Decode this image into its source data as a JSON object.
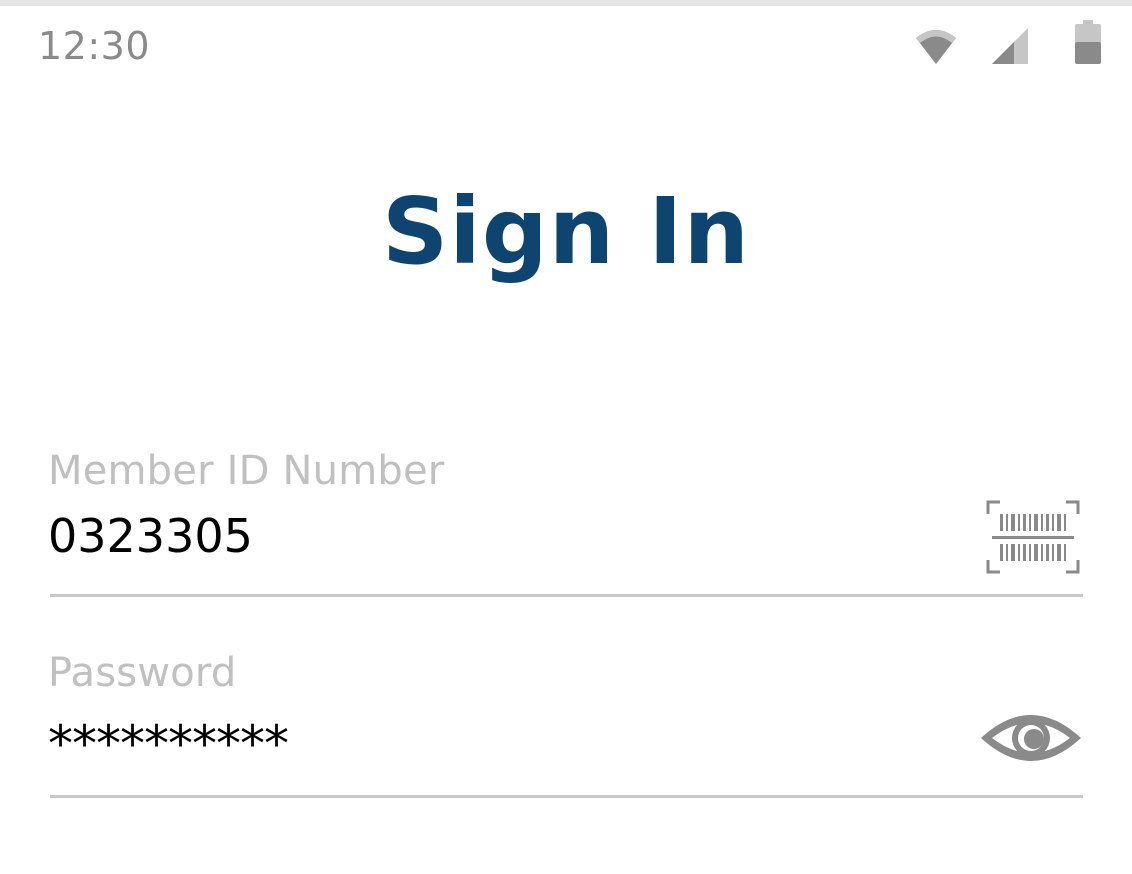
{
  "status_bar": {
    "time": "12:30",
    "icons": [
      "wifi-icon",
      "cellular-signal-icon",
      "battery-icon"
    ]
  },
  "title": "Sign In",
  "form": {
    "member_id": {
      "label": "Member ID Number",
      "value": "0323305",
      "icon": "barcode-scan-icon"
    },
    "password": {
      "label": "Password",
      "value": "**********",
      "icon": "eye-icon"
    }
  },
  "colors": {
    "title": "#0e4470",
    "label": "#c0c0c0",
    "underline": "#c8c8c8",
    "icon": "#8a8a8a"
  }
}
